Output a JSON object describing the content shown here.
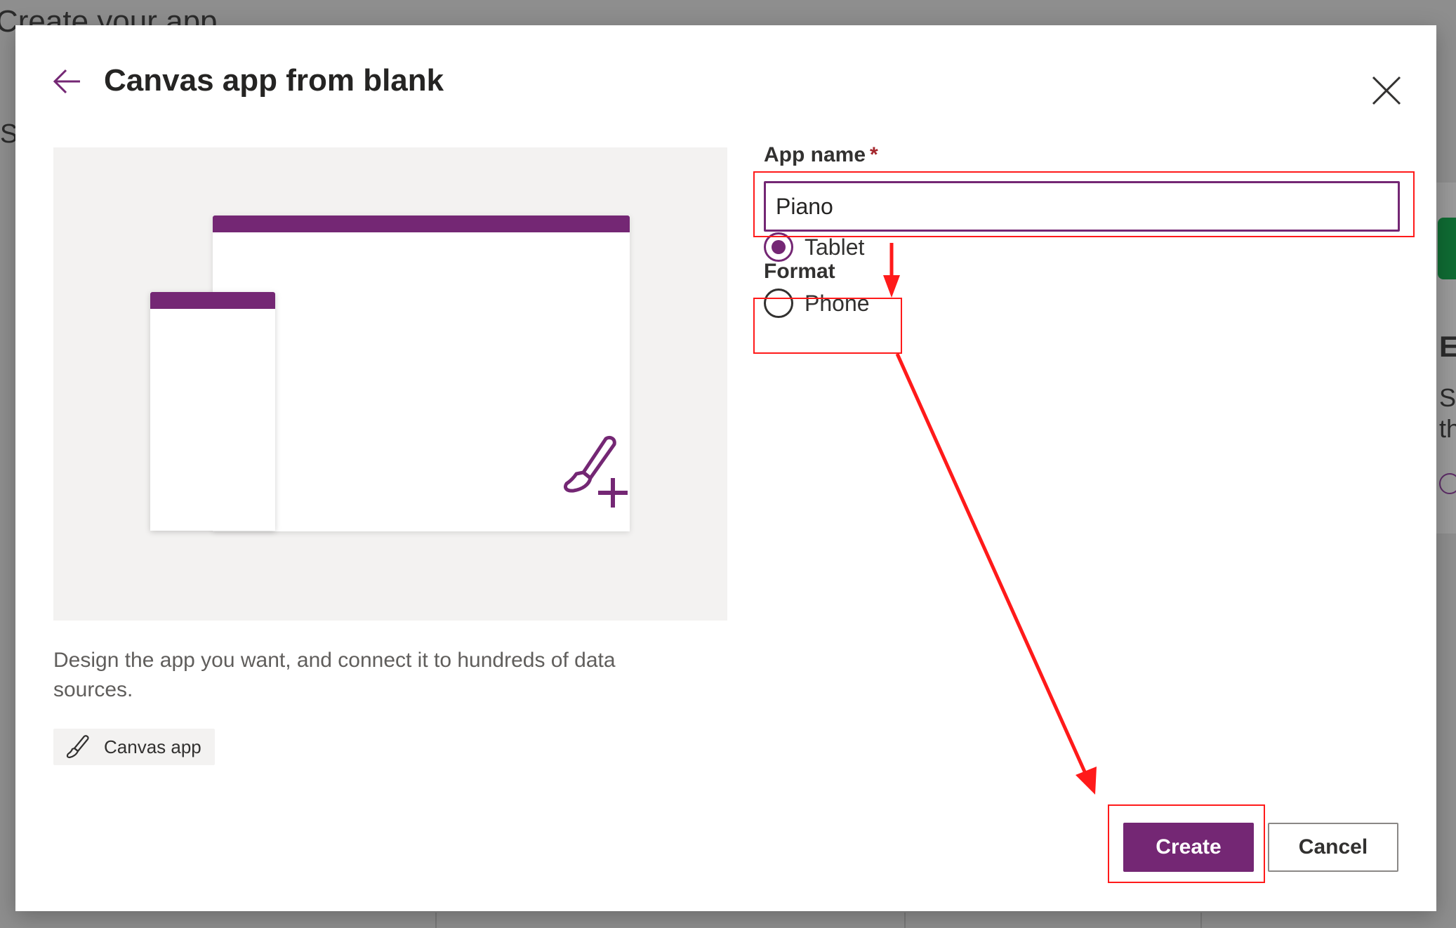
{
  "background": {
    "page_title": "Create your app",
    "left_strip_text": "St",
    "right_strip_heading": "E",
    "right_strip_line1": "St",
    "right_strip_line2": "th"
  },
  "modal": {
    "title": "Canvas app from blank",
    "description": "Design the app you want, and connect it to hundreds of data sources.",
    "tag_label": "Canvas app",
    "form": {
      "app_name_label": "App name",
      "required_marker": "*",
      "app_name_value": "Piano",
      "format_label": "Format",
      "format_options": [
        {
          "label": "Tablet",
          "selected": true
        },
        {
          "label": "Phone",
          "selected": false
        }
      ]
    },
    "buttons": {
      "create_label": "Create",
      "cancel_label": "Cancel"
    }
  },
  "colors": {
    "accent": "#742774",
    "annotation": "#ff1a1a",
    "overlay": "#8e8e8e",
    "preview_bg": "#f3f2f1"
  },
  "icons": {
    "back": "arrow-left-icon",
    "close": "close-icon",
    "illustration": "paintbrush-plus-icon",
    "tag": "paintbrush-icon"
  }
}
